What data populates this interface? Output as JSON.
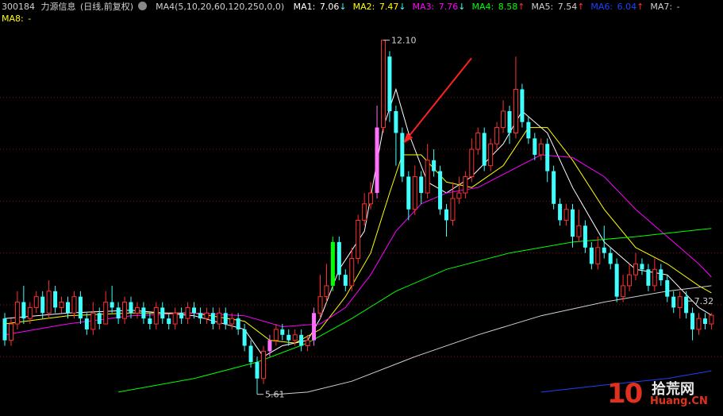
{
  "header": {
    "code": "300184",
    "name": "力源信息",
    "period": "(日线,前复权)",
    "ma_params": "MA4(5,10,20,60,120,250,0,0)",
    "ma": [
      {
        "key": "MA1",
        "label": "MA1:",
        "value": "7.06",
        "arrow": "↓",
        "color": "#ffffff"
      },
      {
        "key": "MA2",
        "label": "MA2:",
        "value": "7.47",
        "arrow": "↓",
        "color": "#ffff00"
      },
      {
        "key": "MA3",
        "label": "MA3:",
        "value": "7.76",
        "arrow": "↓",
        "color": "#ff00ff"
      },
      {
        "key": "MA4",
        "label": "MA4:",
        "value": "8.58",
        "arrow": "↑",
        "color": "#00ff00"
      },
      {
        "key": "MA5",
        "label": "MA5:",
        "value": "7.54",
        "arrow": "↑",
        "color": "#d0d0d0"
      },
      {
        "key": "MA6",
        "label": "MA6:",
        "value": "6.04",
        "arrow": "↑",
        "color": "#2040ff"
      },
      {
        "key": "MA7",
        "label": "MA7:",
        "value": "-",
        "arrow": "",
        "color": "#d0d0d0"
      },
      {
        "key": "MA8",
        "label": "MA8:",
        "value": "-",
        "arrow": "",
        "color": "#ffff00"
      }
    ]
  },
  "chart_data": {
    "type": "candlestick",
    "ylim": [
      5.3,
      12.4
    ],
    "gridlines": [
      11.05,
      10.1,
      9.15,
      8.2,
      7.25,
      6.3
    ],
    "annotations": [
      {
        "text": "12.10",
        "price": 12.1,
        "bar_index": 60
      },
      {
        "text": "5.61",
        "price": 5.61,
        "bar_index": 40
      },
      {
        "text": "7.32",
        "price": 7.32,
        "bar_index": 108
      }
    ],
    "candles": [
      [
        7.0,
        6.6,
        7.1,
        6.5
      ],
      [
        6.6,
        6.9,
        7.0,
        6.5
      ],
      [
        6.9,
        7.3,
        7.5,
        6.8
      ],
      [
        7.3,
        7.0,
        7.6,
        6.9
      ],
      [
        7.0,
        7.2,
        7.3,
        6.9
      ],
      [
        7.2,
        7.4,
        7.5,
        7.1
      ],
      [
        7.4,
        7.1,
        7.5,
        7.0
      ],
      [
        7.1,
        7.5,
        7.7,
        7.0
      ],
      [
        7.5,
        7.2,
        7.6,
        7.1
      ],
      [
        7.2,
        7.3,
        7.4,
        7.1
      ],
      [
        7.3,
        7.1,
        7.4,
        7.0
      ],
      [
        7.1,
        7.4,
        7.5,
        7.0
      ],
      [
        7.4,
        7.0,
        7.5,
        6.9
      ],
      [
        7.0,
        6.8,
        7.1,
        6.7
      ],
      [
        6.8,
        7.1,
        7.3,
        6.7
      ],
      [
        7.1,
        6.9,
        7.2,
        6.8
      ],
      [
        6.9,
        7.3,
        7.5,
        6.9
      ],
      [
        7.3,
        7.2,
        7.6,
        7.1
      ],
      [
        7.2,
        7.0,
        7.3,
        6.9
      ],
      [
        7.0,
        7.3,
        7.4,
        6.9
      ],
      [
        7.3,
        7.1,
        7.4,
        7.0
      ],
      [
        7.1,
        7.2,
        7.3,
        7.0
      ],
      [
        7.2,
        7.0,
        7.3,
        6.9
      ],
      [
        7.0,
        6.9,
        7.1,
        6.8
      ],
      [
        6.9,
        7.2,
        7.3,
        6.8
      ],
      [
        7.2,
        7.0,
        7.3,
        6.9
      ],
      [
        7.0,
        6.9,
        7.1,
        6.8
      ],
      [
        6.9,
        7.1,
        7.2,
        6.8
      ],
      [
        7.1,
        7.0,
        7.2,
        6.9
      ],
      [
        7.0,
        7.2,
        7.3,
        6.9
      ],
      [
        7.2,
        7.1,
        7.3,
        7.0
      ],
      [
        7.1,
        7.0,
        7.2,
        6.9
      ],
      [
        7.0,
        7.1,
        7.2,
        6.9
      ],
      [
        7.1,
        6.9,
        7.2,
        6.8
      ],
      [
        6.9,
        7.1,
        7.2,
        6.8
      ],
      [
        7.1,
        6.9,
        7.2,
        6.8
      ],
      [
        6.9,
        7.0,
        7.1,
        6.8
      ],
      [
        7.0,
        6.8,
        7.1,
        6.7
      ],
      [
        6.8,
        6.5,
        6.9,
        6.4
      ],
      [
        6.5,
        6.2,
        6.6,
        6.1
      ],
      [
        6.2,
        5.9,
        6.3,
        5.61
      ],
      [
        5.9,
        6.4,
        6.5,
        5.8
      ],
      [
        6.4,
        6.6,
        6.7,
        6.3
      ],
      [
        6.6,
        6.8,
        6.9,
        6.5
      ],
      [
        6.8,
        6.7,
        6.9,
        6.6
      ],
      [
        6.7,
        6.6,
        6.8,
        6.5
      ],
      [
        6.6,
        6.7,
        6.8,
        6.5
      ],
      [
        6.7,
        6.5,
        6.8,
        6.4
      ],
      [
        6.5,
        6.6,
        6.7,
        6.4
      ],
      [
        6.6,
        7.1,
        7.2,
        6.5
      ],
      [
        7.1,
        7.4,
        7.8,
        7.0
      ],
      [
        7.4,
        7.6,
        8.0,
        7.3
      ],
      [
        7.6,
        8.4,
        8.5,
        7.5
      ],
      [
        8.4,
        7.8,
        8.5,
        7.7
      ],
      [
        7.8,
        7.6,
        7.9,
        7.5
      ],
      [
        7.6,
        8.1,
        8.3,
        7.5
      ],
      [
        8.1,
        8.8,
        8.9,
        8.0
      ],
      [
        8.8,
        9.1,
        9.3,
        8.7
      ],
      [
        9.1,
        9.3,
        9.5,
        9.0
      ],
      [
        9.3,
        10.5,
        10.9,
        9.2
      ],
      [
        10.5,
        12.1,
        12.1,
        10.4
      ],
      [
        11.8,
        10.8,
        11.9,
        10.6
      ],
      [
        10.8,
        10.4,
        10.9,
        9.8
      ],
      [
        10.4,
        9.6,
        10.5,
        9.5
      ],
      [
        9.6,
        9.0,
        9.7,
        8.8
      ],
      [
        9.0,
        9.6,
        9.8,
        8.9
      ],
      [
        9.6,
        9.3,
        9.7,
        9.1
      ],
      [
        9.3,
        9.9,
        10.2,
        9.2
      ],
      [
        9.9,
        9.7,
        10.1,
        9.6
      ],
      [
        9.7,
        9.0,
        9.8,
        8.9
      ],
      [
        9.0,
        8.8,
        9.1,
        8.5
      ],
      [
        8.8,
        9.2,
        9.5,
        8.7
      ],
      [
        9.2,
        9.3,
        9.6,
        9.1
      ],
      [
        9.3,
        9.6,
        9.7,
        9.2
      ],
      [
        9.6,
        10.1,
        10.3,
        9.5
      ],
      [
        10.1,
        10.4,
        10.5,
        10.0
      ],
      [
        10.4,
        9.8,
        10.5,
        9.7
      ],
      [
        9.8,
        10.2,
        10.3,
        9.7
      ],
      [
        10.2,
        10.5,
        10.6,
        10.1
      ],
      [
        10.5,
        10.8,
        11.0,
        10.4
      ],
      [
        10.8,
        10.4,
        10.9,
        10.2
      ],
      [
        10.4,
        11.2,
        11.8,
        10.3
      ],
      [
        11.2,
        10.6,
        11.3,
        10.5
      ],
      [
        10.6,
        10.3,
        10.7,
        10.2
      ],
      [
        10.3,
        10.0,
        10.4,
        9.9
      ],
      [
        10.0,
        10.2,
        10.3,
        9.9
      ],
      [
        10.2,
        9.7,
        10.3,
        9.5
      ],
      [
        9.7,
        9.1,
        9.8,
        9.0
      ],
      [
        9.1,
        8.8,
        9.2,
        8.7
      ],
      [
        8.8,
        9.0,
        9.1,
        8.7
      ],
      [
        9.0,
        8.5,
        9.1,
        8.3
      ],
      [
        8.5,
        8.7,
        9.0,
        8.4
      ],
      [
        8.7,
        8.3,
        8.8,
        8.2
      ],
      [
        8.3,
        8.0,
        8.4,
        7.9
      ],
      [
        8.0,
        8.3,
        8.5,
        7.9
      ],
      [
        8.3,
        8.2,
        8.7,
        8.1
      ],
      [
        8.2,
        8.0,
        8.3,
        7.9
      ],
      [
        8.0,
        7.4,
        8.1,
        7.3
      ],
      [
        7.4,
        7.6,
        7.8,
        7.3
      ],
      [
        7.6,
        7.8,
        8.0,
        7.5
      ],
      [
        7.8,
        8.0,
        8.2,
        7.7
      ],
      [
        8.0,
        7.9,
        8.1,
        7.8
      ],
      [
        7.9,
        7.6,
        8.0,
        7.5
      ],
      [
        7.6,
        7.9,
        8.1,
        7.5
      ],
      [
        7.9,
        7.7,
        8.0,
        7.6
      ],
      [
        7.7,
        7.4,
        7.8,
        7.3
      ],
      [
        7.4,
        7.2,
        7.5,
        7.1
      ],
      [
        7.2,
        7.4,
        7.5,
        7.0
      ],
      [
        7.4,
        7.1,
        7.5,
        7.0
      ],
      [
        7.1,
        6.8,
        7.2,
        6.6
      ],
      [
        6.8,
        7.0,
        7.1,
        6.7
      ],
      [
        7.0,
        6.9,
        7.1,
        6.8
      ],
      [
        6.9,
        7.06,
        7.1,
        6.8
      ]
    ],
    "ma_series": [
      {
        "name": "MA1",
        "color": "#ffffff",
        "points": [
          [
            0,
            7.0
          ],
          [
            10,
            7.1
          ],
          [
            20,
            7.15
          ],
          [
            30,
            7.05
          ],
          [
            38,
            6.8
          ],
          [
            41,
            6.3
          ],
          [
            44,
            6.5
          ],
          [
            48,
            6.6
          ],
          [
            50,
            7.0
          ],
          [
            53,
            7.9
          ],
          [
            57,
            8.6
          ],
          [
            60,
            10.5
          ],
          [
            62,
            11.2
          ],
          [
            64,
            10.4
          ],
          [
            67,
            9.5
          ],
          [
            70,
            9.3
          ],
          [
            74,
            9.6
          ],
          [
            79,
            10.2
          ],
          [
            82,
            10.8
          ],
          [
            86,
            10.4
          ],
          [
            90,
            9.4
          ],
          [
            95,
            8.4
          ],
          [
            100,
            7.9
          ],
          [
            105,
            7.8
          ],
          [
            110,
            7.2
          ],
          [
            112,
            7.06
          ]
        ]
      },
      {
        "name": "MA2",
        "color": "#ffff00",
        "points": [
          [
            0,
            6.9
          ],
          [
            10,
            7.05
          ],
          [
            20,
            7.1
          ],
          [
            30,
            7.1
          ],
          [
            38,
            6.95
          ],
          [
            42,
            6.6
          ],
          [
            46,
            6.55
          ],
          [
            50,
            6.8
          ],
          [
            54,
            7.4
          ],
          [
            58,
            8.2
          ],
          [
            61,
            9.3
          ],
          [
            63,
            10.0
          ],
          [
            66,
            10.0
          ],
          [
            70,
            9.5
          ],
          [
            74,
            9.4
          ],
          [
            79,
            9.8
          ],
          [
            83,
            10.5
          ],
          [
            86,
            10.5
          ],
          [
            90,
            9.9
          ],
          [
            95,
            9.0
          ],
          [
            100,
            8.3
          ],
          [
            105,
            8.0
          ],
          [
            110,
            7.6
          ],
          [
            112,
            7.47
          ]
        ]
      },
      {
        "name": "MA3",
        "color": "#ff00ff",
        "points": [
          [
            0,
            6.7
          ],
          [
            10,
            6.9
          ],
          [
            20,
            7.05
          ],
          [
            30,
            7.1
          ],
          [
            38,
            7.05
          ],
          [
            44,
            6.85
          ],
          [
            50,
            6.9
          ],
          [
            54,
            7.2
          ],
          [
            58,
            7.8
          ],
          [
            62,
            8.6
          ],
          [
            66,
            9.1
          ],
          [
            70,
            9.3
          ],
          [
            75,
            9.4
          ],
          [
            80,
            9.7
          ],
          [
            85,
            10.0
          ],
          [
            90,
            9.95
          ],
          [
            95,
            9.6
          ],
          [
            100,
            9.0
          ],
          [
            105,
            8.5
          ],
          [
            110,
            8.0
          ],
          [
            112,
            7.76
          ]
        ]
      },
      {
        "name": "MA4",
        "color": "#00ff00",
        "points": [
          [
            18,
            5.65
          ],
          [
            30,
            5.9
          ],
          [
            40,
            6.2
          ],
          [
            48,
            6.55
          ],
          [
            55,
            7.0
          ],
          [
            62,
            7.5
          ],
          [
            70,
            7.9
          ],
          [
            80,
            8.2
          ],
          [
            90,
            8.4
          ],
          [
            100,
            8.5
          ],
          [
            112,
            8.65
          ]
        ]
      },
      {
        "name": "MA5",
        "color": "#d0d0d0",
        "points": [
          [
            42,
            5.6
          ],
          [
            48,
            5.65
          ],
          [
            55,
            5.85
          ],
          [
            65,
            6.3
          ],
          [
            75,
            6.7
          ],
          [
            85,
            7.05
          ],
          [
            95,
            7.3
          ],
          [
            105,
            7.5
          ],
          [
            112,
            7.6
          ]
        ]
      },
      {
        "name": "MA6",
        "color": "#2040ff",
        "points": [
          [
            85,
            5.65
          ],
          [
            95,
            5.78
          ],
          [
            105,
            5.9
          ],
          [
            112,
            6.04
          ]
        ]
      }
    ]
  },
  "arrow": {
    "from": [
      0.652,
      0.14
    ],
    "to": [
      0.558,
      0.345
    ]
  },
  "watermark": {
    "logo": "10",
    "cn": "拾荒网",
    "url": "Huang.CN"
  }
}
